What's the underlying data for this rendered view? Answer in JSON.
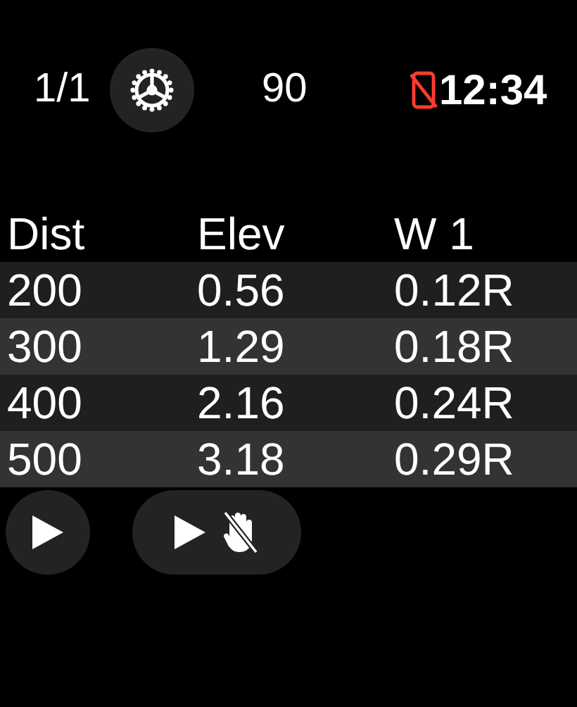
{
  "top_bar": {
    "page": "1/1",
    "value": "90",
    "time": "12:34"
  },
  "table": {
    "columns": [
      "Dist",
      "Elev",
      "W 1"
    ],
    "rows": [
      [
        "200",
        "0.56",
        "0.12R"
      ],
      [
        "300",
        "1.29",
        "0.18R"
      ],
      [
        "400",
        "2.16",
        "0.24R"
      ],
      [
        "500",
        "3.18",
        "0.29R"
      ]
    ]
  }
}
